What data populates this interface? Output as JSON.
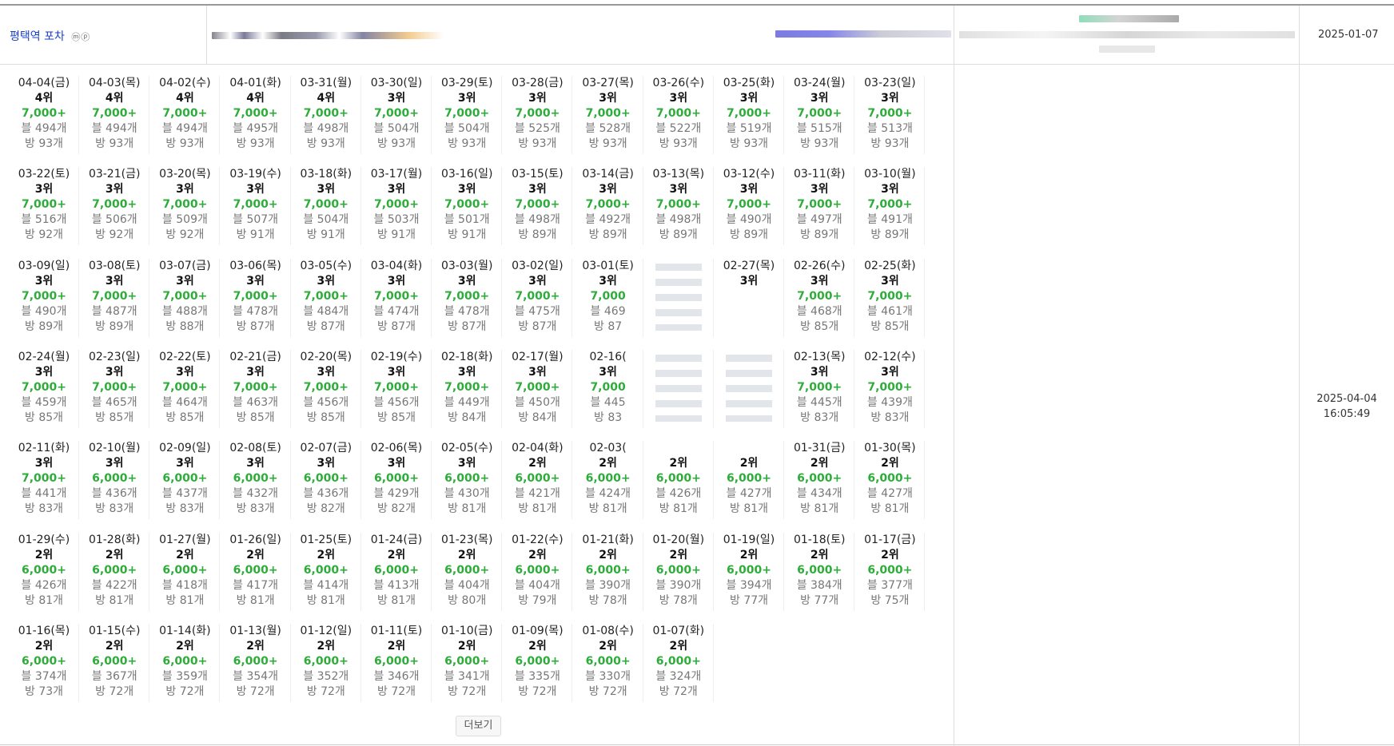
{
  "header": {
    "keyword": "평택역 포차",
    "keyword_badges": "ⓜⓟ",
    "registered_date": "2025-01-07",
    "updated_date": "2025-04-04",
    "updated_time": "16:05:49"
  },
  "more_button": "더보기",
  "rows": [
    [
      {
        "date": "04-04(금)",
        "rank": "4위",
        "search": "7,000+",
        "blog": "494개",
        "bang": "93개"
      },
      {
        "date": "04-03(목)",
        "rank": "4위",
        "search": "7,000+",
        "blog": "494개",
        "bang": "93개"
      },
      {
        "date": "04-02(수)",
        "rank": "4위",
        "search": "7,000+",
        "blog": "494개",
        "bang": "93개"
      },
      {
        "date": "04-01(화)",
        "rank": "4위",
        "search": "7,000+",
        "blog": "495개",
        "bang": "93개"
      },
      {
        "date": "03-31(월)",
        "rank": "4위",
        "search": "7,000+",
        "blog": "498개",
        "bang": "93개"
      },
      {
        "date": "03-30(일)",
        "rank": "3위",
        "search": "7,000+",
        "blog": "504개",
        "bang": "93개"
      },
      {
        "date": "03-29(토)",
        "rank": "3위",
        "search": "7,000+",
        "blog": "504개",
        "bang": "93개"
      },
      {
        "date": "03-28(금)",
        "rank": "3위",
        "search": "7,000+",
        "blog": "525개",
        "bang": "93개"
      },
      {
        "date": "03-27(목)",
        "rank": "3위",
        "search": "7,000+",
        "blog": "528개",
        "bang": "93개"
      },
      {
        "date": "03-26(수)",
        "rank": "3위",
        "search": "7,000+",
        "blog": "522개",
        "bang": "93개"
      },
      {
        "date": "03-25(화)",
        "rank": "3위",
        "search": "7,000+",
        "blog": "519개",
        "bang": "93개"
      },
      {
        "date": "03-24(월)",
        "rank": "3위",
        "search": "7,000+",
        "blog": "515개",
        "bang": "93개"
      },
      {
        "date": "03-23(일)",
        "rank": "3위",
        "search": "7,000+",
        "blog": "513개",
        "bang": "93개"
      }
    ],
    [
      {
        "date": "03-22(토)",
        "rank": "3위",
        "search": "7,000+",
        "blog": "516개",
        "bang": "92개"
      },
      {
        "date": "03-21(금)",
        "rank": "3위",
        "search": "7,000+",
        "blog": "506개",
        "bang": "92개"
      },
      {
        "date": "03-20(목)",
        "rank": "3위",
        "search": "7,000+",
        "blog": "509개",
        "bang": "92개"
      },
      {
        "date": "03-19(수)",
        "rank": "3위",
        "search": "7,000+",
        "blog": "507개",
        "bang": "91개"
      },
      {
        "date": "03-18(화)",
        "rank": "3위",
        "search": "7,000+",
        "blog": "504개",
        "bang": "91개"
      },
      {
        "date": "03-17(월)",
        "rank": "3위",
        "search": "7,000+",
        "blog": "503개",
        "bang": "91개"
      },
      {
        "date": "03-16(일)",
        "rank": "3위",
        "search": "7,000+",
        "blog": "501개",
        "bang": "91개"
      },
      {
        "date": "03-15(토)",
        "rank": "3위",
        "search": "7,000+",
        "blog": "498개",
        "bang": "89개"
      },
      {
        "date": "03-14(금)",
        "rank": "3위",
        "search": "7,000+",
        "blog": "492개",
        "bang": "89개"
      },
      {
        "date": "03-13(목)",
        "rank": "3위",
        "search": "7,000+",
        "blog": "498개",
        "bang": "89개"
      },
      {
        "date": "03-12(수)",
        "rank": "3위",
        "search": "7,000+",
        "blog": "490개",
        "bang": "89개"
      },
      {
        "date": "03-11(화)",
        "rank": "3위",
        "search": "7,000+",
        "blog": "497개",
        "bang": "89개"
      },
      {
        "date": "03-10(월)",
        "rank": "3위",
        "search": "7,000+",
        "blog": "491개",
        "bang": "89개"
      }
    ],
    [
      {
        "date": "03-09(일)",
        "rank": "3위",
        "search": "7,000+",
        "blog": "490개",
        "bang": "89개"
      },
      {
        "date": "03-08(토)",
        "rank": "3위",
        "search": "7,000+",
        "blog": "487개",
        "bang": "89개"
      },
      {
        "date": "03-07(금)",
        "rank": "3위",
        "search": "7,000+",
        "blog": "488개",
        "bang": "88개"
      },
      {
        "date": "03-06(목)",
        "rank": "3위",
        "search": "7,000+",
        "blog": "478개",
        "bang": "87개"
      },
      {
        "date": "03-05(수)",
        "rank": "3위",
        "search": "7,000+",
        "blog": "484개",
        "bang": "87개"
      },
      {
        "date": "03-04(화)",
        "rank": "3위",
        "search": "7,000+",
        "blog": "474개",
        "bang": "87개"
      },
      {
        "date": "03-03(월)",
        "rank": "3위",
        "search": "7,000+",
        "blog": "478개",
        "bang": "87개"
      },
      {
        "date": "03-02(일)",
        "rank": "3위",
        "search": "7,000+",
        "blog": "475개",
        "bang": "87개"
      },
      {
        "date": "03-01(토)",
        "rank": "3위",
        "search": "7,000",
        "blog": "469",
        "bang": "87"
      },
      {
        "date": "",
        "rank": "",
        "search": "",
        "blog": "",
        "bang": ""
      },
      {
        "date": "02-27(목)",
        "rank": "3위",
        "search": "",
        "blog": "",
        "bang": ""
      },
      {
        "date": "02-26(수)",
        "rank": "3위",
        "search": "7,000+",
        "blog": "468개",
        "bang": "85개"
      },
      {
        "date": "02-25(화)",
        "rank": "3위",
        "search": "7,000+",
        "blog": "461개",
        "bang": "85개"
      }
    ],
    [
      {
        "date": "02-24(월)",
        "rank": "3위",
        "search": "7,000+",
        "blog": "459개",
        "bang": "85개"
      },
      {
        "date": "02-23(일)",
        "rank": "3위",
        "search": "7,000+",
        "blog": "465개",
        "bang": "85개"
      },
      {
        "date": "02-22(토)",
        "rank": "3위",
        "search": "7,000+",
        "blog": "464개",
        "bang": "85개"
      },
      {
        "date": "02-21(금)",
        "rank": "3위",
        "search": "7,000+",
        "blog": "463개",
        "bang": "85개"
      },
      {
        "date": "02-20(목)",
        "rank": "3위",
        "search": "7,000+",
        "blog": "456개",
        "bang": "85개"
      },
      {
        "date": "02-19(수)",
        "rank": "3위",
        "search": "7,000+",
        "blog": "456개",
        "bang": "85개"
      },
      {
        "date": "02-18(화)",
        "rank": "3위",
        "search": "7,000+",
        "blog": "449개",
        "bang": "84개"
      },
      {
        "date": "02-17(월)",
        "rank": "3위",
        "search": "7,000+",
        "blog": "450개",
        "bang": "84개"
      },
      {
        "date": "02-16(",
        "rank": "3위",
        "search": "7,000",
        "blog": "445",
        "bang": "83"
      },
      {
        "date": "",
        "rank": "",
        "search": "",
        "blog": "",
        "bang": ""
      },
      {
        "date": "",
        "rank": "",
        "search": "",
        "blog": "",
        "bang": ""
      },
      {
        "date": "02-13(목)",
        "rank": "3위",
        "search": "7,000+",
        "blog": "445개",
        "bang": "83개"
      },
      {
        "date": "02-12(수)",
        "rank": "3위",
        "search": "7,000+",
        "blog": "439개",
        "bang": "83개"
      }
    ],
    [
      {
        "date": "02-11(화)",
        "rank": "3위",
        "search": "7,000+",
        "blog": "441개",
        "bang": "83개"
      },
      {
        "date": "02-10(월)",
        "rank": "3위",
        "search": "6,000+",
        "blog": "436개",
        "bang": "83개"
      },
      {
        "date": "02-09(일)",
        "rank": "3위",
        "search": "6,000+",
        "blog": "437개",
        "bang": "83개"
      },
      {
        "date": "02-08(토)",
        "rank": "3위",
        "search": "6,000+",
        "blog": "432개",
        "bang": "83개"
      },
      {
        "date": "02-07(금)",
        "rank": "3위",
        "search": "6,000+",
        "blog": "436개",
        "bang": "82개"
      },
      {
        "date": "02-06(목)",
        "rank": "3위",
        "search": "6,000+",
        "blog": "429개",
        "bang": "82개"
      },
      {
        "date": "02-05(수)",
        "rank": "3위",
        "search": "6,000+",
        "blog": "430개",
        "bang": "81개"
      },
      {
        "date": "02-04(화)",
        "rank": "2위",
        "search": "6,000+",
        "blog": "421개",
        "bang": "81개"
      },
      {
        "date": "02-03(",
        "rank": "2위",
        "search": "6,000+",
        "blog": "424개",
        "bang": "81개"
      },
      {
        "date": "",
        "rank": "2위",
        "search": "6,000+",
        "blog": "426개",
        "bang": "81개"
      },
      {
        "date": "",
        "rank": "2위",
        "search": "6,000+",
        "blog": "427개",
        "bang": "81개"
      },
      {
        "date": "01-31(금)",
        "rank": "2위",
        "search": "6,000+",
        "blog": "434개",
        "bang": "81개"
      },
      {
        "date": "01-30(목)",
        "rank": "2위",
        "search": "6,000+",
        "blog": "427개",
        "bang": "81개"
      }
    ],
    [
      {
        "date": "01-29(수)",
        "rank": "2위",
        "search": "6,000+",
        "blog": "426개",
        "bang": "81개"
      },
      {
        "date": "01-28(화)",
        "rank": "2위",
        "search": "6,000+",
        "blog": "422개",
        "bang": "81개"
      },
      {
        "date": "01-27(월)",
        "rank": "2위",
        "search": "6,000+",
        "blog": "418개",
        "bang": "81개"
      },
      {
        "date": "01-26(일)",
        "rank": "2위",
        "search": "6,000+",
        "blog": "417개",
        "bang": "81개"
      },
      {
        "date": "01-25(토)",
        "rank": "2위",
        "search": "6,000+",
        "blog": "414개",
        "bang": "81개"
      },
      {
        "date": "01-24(금)",
        "rank": "2위",
        "search": "6,000+",
        "blog": "413개",
        "bang": "81개"
      },
      {
        "date": "01-23(목)",
        "rank": "2위",
        "search": "6,000+",
        "blog": "404개",
        "bang": "80개"
      },
      {
        "date": "01-22(수)",
        "rank": "2위",
        "search": "6,000+",
        "blog": "404개",
        "bang": "79개"
      },
      {
        "date": "01-21(화)",
        "rank": "2위",
        "search": "6,000+",
        "blog": "390개",
        "bang": "78개"
      },
      {
        "date": "01-20(월)",
        "rank": "2위",
        "search": "6,000+",
        "blog": "390개",
        "bang": "78개"
      },
      {
        "date": "01-19(일)",
        "rank": "2위",
        "search": "6,000+",
        "blog": "394개",
        "bang": "77개"
      },
      {
        "date": "01-18(토)",
        "rank": "2위",
        "search": "6,000+",
        "blog": "384개",
        "bang": "77개"
      },
      {
        "date": "01-17(금)",
        "rank": "2위",
        "search": "6,000+",
        "blog": "377개",
        "bang": "75개"
      }
    ],
    [
      {
        "date": "01-16(목)",
        "rank": "2위",
        "search": "6,000+",
        "blog": "374개",
        "bang": "73개"
      },
      {
        "date": "01-15(수)",
        "rank": "2위",
        "search": "6,000+",
        "blog": "367개",
        "bang": "72개"
      },
      {
        "date": "01-14(화)",
        "rank": "2위",
        "search": "6,000+",
        "blog": "359개",
        "bang": "72개"
      },
      {
        "date": "01-13(월)",
        "rank": "2위",
        "search": "6,000+",
        "blog": "354개",
        "bang": "72개"
      },
      {
        "date": "01-12(일)",
        "rank": "2위",
        "search": "6,000+",
        "blog": "352개",
        "bang": "72개"
      },
      {
        "date": "01-11(토)",
        "rank": "2위",
        "search": "6,000+",
        "blog": "346개",
        "bang": "72개"
      },
      {
        "date": "01-10(금)",
        "rank": "2위",
        "search": "6,000+",
        "blog": "341개",
        "bang": "72개"
      },
      {
        "date": "01-09(목)",
        "rank": "2위",
        "search": "6,000+",
        "blog": "335개",
        "bang": "72개"
      },
      {
        "date": "01-08(수)",
        "rank": "2위",
        "search": "6,000+",
        "blog": "330개",
        "bang": "72개"
      },
      {
        "date": "01-07(화)",
        "rank": "2위",
        "search": "6,000+",
        "blog": "324개",
        "bang": "72개"
      }
    ]
  ],
  "labels": {
    "blog_prefix": "블",
    "bang_prefix": "방"
  },
  "colors": {
    "keyword": "#1a3fc4",
    "search_count": "#2eac3a",
    "meta": "#777777"
  }
}
